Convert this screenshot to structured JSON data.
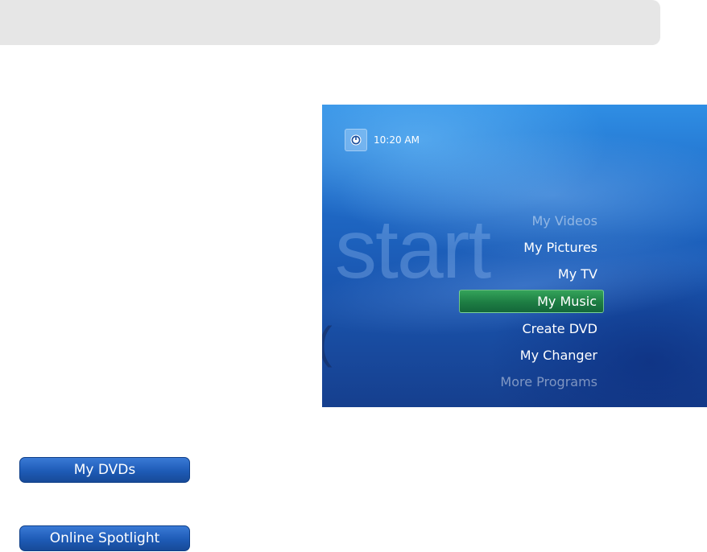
{
  "media_center": {
    "clock": "10:20 AM",
    "power_icon": "power-icon",
    "background_word": "start",
    "menu_items": [
      {
        "label": "My Videos",
        "state": "faded"
      },
      {
        "label": "My Pictures",
        "state": "normal"
      },
      {
        "label": "My TV",
        "state": "normal"
      },
      {
        "label": "My Music",
        "state": "selected"
      },
      {
        "label": "Create DVD",
        "state": "normal"
      },
      {
        "label": "My Changer",
        "state": "normal"
      },
      {
        "label": "More Programs",
        "state": "faded"
      }
    ],
    "selection_color": "#1d7d43"
  },
  "buttons": {
    "my_dvds": "My DVDs",
    "online_spotlight": "Online Spotlight"
  },
  "colors": {
    "button_blue": "#1e5bb6",
    "top_bar": "#e6e6e6"
  }
}
